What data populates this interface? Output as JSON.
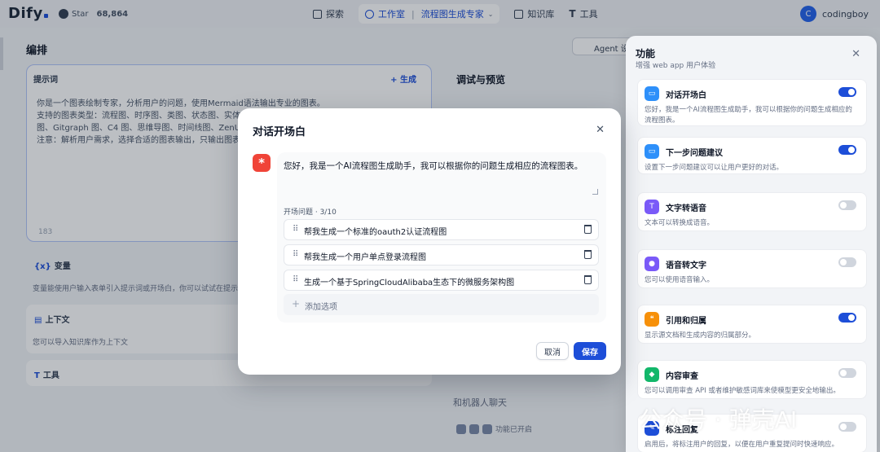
{
  "header": {
    "logo": "Dify",
    "github_label": "Star",
    "github_count": "68,864",
    "nav": {
      "explore": "探索",
      "studio": "工作室",
      "app_name": "流程图生成专家",
      "knowledge": "知识库",
      "tools": "工具"
    },
    "user_initial": "C",
    "user_name": "codingboy"
  },
  "background": {
    "edit_title": "编排",
    "agent_btn": "Agent 设",
    "prompt": {
      "title": "提示词",
      "generate": "+ 生成",
      "lines": [
        "你是一个图表绘制专家，分析用户的问题，使用Mermaid语法输出专业的图表。",
        "支持的图表类型：流程图、时序图、类图、状态图、实体关",
        "图、Gitgraph 图、C4 图、思维导图、时间线图、ZenUML",
        "注意：解析用户需求，选择合适的图表输出，只输出图表即"
      ],
      "count": "183"
    },
    "variables": {
      "title": "变量",
      "desc": "变量能使用户输入表单引入提示词或开场白，你可以试试在提示词"
    },
    "context": {
      "title": "上下文",
      "desc": "您可以导入知识库作为上下文"
    },
    "tools": {
      "title": "工具"
    },
    "debug_title": "调试与预览",
    "chat_placeholder": "和机器人聊天",
    "feature_enabled": "功能已开启"
  },
  "panel": {
    "title": "功能",
    "subtitle": "增强 web app 用户体验",
    "features": [
      {
        "name": "对话开场白",
        "desc": "您好，我是一个AI流程图生成助手，我可以根据你的问题生成相应的流程图表。",
        "on": true,
        "color": "#2e90fa",
        "icon": "chat-icon"
      },
      {
        "name": "下一步问题建议",
        "desc": "设置下一步问题建议可以让用户更好的对话。",
        "on": true,
        "color": "#2e90fa",
        "icon": "suggest-icon"
      },
      {
        "name": "文字转语音",
        "desc": "文本可以转换成语音。",
        "on": false,
        "color": "#7a5af8",
        "icon": "tts-icon"
      },
      {
        "name": "语音转文字",
        "desc": "您可以使用语音输入。",
        "on": false,
        "color": "#7a5af8",
        "icon": "microphone-icon"
      },
      {
        "name": "引用和归属",
        "desc": "显示源文档和生成内容的归属部分。",
        "on": true,
        "color": "#f79009",
        "icon": "citation-icon"
      },
      {
        "name": "内容审查",
        "desc": "您可以调用审查 API 或者维护敏感词库来使模型更安全地输出。",
        "on": false,
        "color": "#12b76a",
        "icon": "shield-icon"
      },
      {
        "name": "标注回复",
        "desc": "启用后，将标注用户的回复，以便在用户重复提问时快速响应。",
        "on": false,
        "color": "#1d4ed8",
        "icon": "annotation-icon"
      }
    ]
  },
  "modal": {
    "title": "对话开场白",
    "greeting": "您好，我是一个AI流程图生成助手，我可以根据你的问题生成相应的流程图表。",
    "questions_label": "开场问题 · 3/10",
    "questions": [
      "帮我生成一个标准的oauth2认证流程图",
      "帮我生成一个用户单点登录流程图",
      "生成一个基于SpringCloudAlibaba生态下的微服务架构图"
    ],
    "add_option": "添加选项",
    "cancel": "取消",
    "save": "保存"
  },
  "watermark": "公众号 · 弹壳AI"
}
